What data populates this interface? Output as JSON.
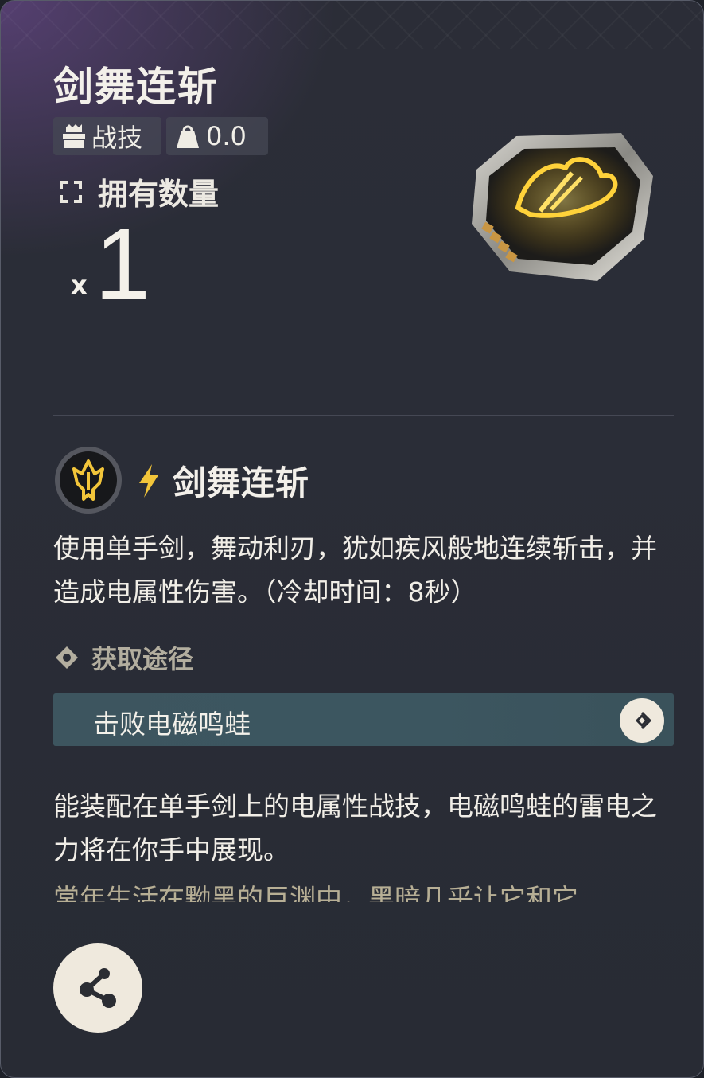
{
  "item": {
    "title": "剑舞连斩",
    "type_tag": "战技",
    "weight": "0.0",
    "own_label": "拥有数量",
    "qty_prefix": "x",
    "qty": "1"
  },
  "skill": {
    "name": "剑舞连斩",
    "description": "使用单手剑，舞动利刃，犹如疾风般地连续斩击，并造成电属性伤害。（冷却时间：8秒）"
  },
  "source": {
    "header": "获取途径",
    "entry": "击败电磁鸣蛙"
  },
  "lore": {
    "line1": "能装配在单手剑上的电属性战技，电磁鸣蛙的雷电之力将在你手中展现。",
    "line2_faded": "常年生活在黝黑的巨渊中，黑暗几乎让它和它"
  },
  "icons": {
    "type": "chest-icon",
    "weight": "weight-icon",
    "own": "target-crosshair-icon",
    "item": "electro-sword-chip-icon",
    "skill": "electro-sword-skill-icon",
    "element": "lightning-bolt-icon",
    "source_header": "diamond-icon",
    "source_go": "chevron-right-icon",
    "share": "share-icon"
  },
  "colors": {
    "accent_gold": "#f2c53a",
    "text_primary": "#f1eee7",
    "source_bar": "#3d555f",
    "button_bg": "#efe9dd",
    "lore_faded": "#b7af95"
  }
}
